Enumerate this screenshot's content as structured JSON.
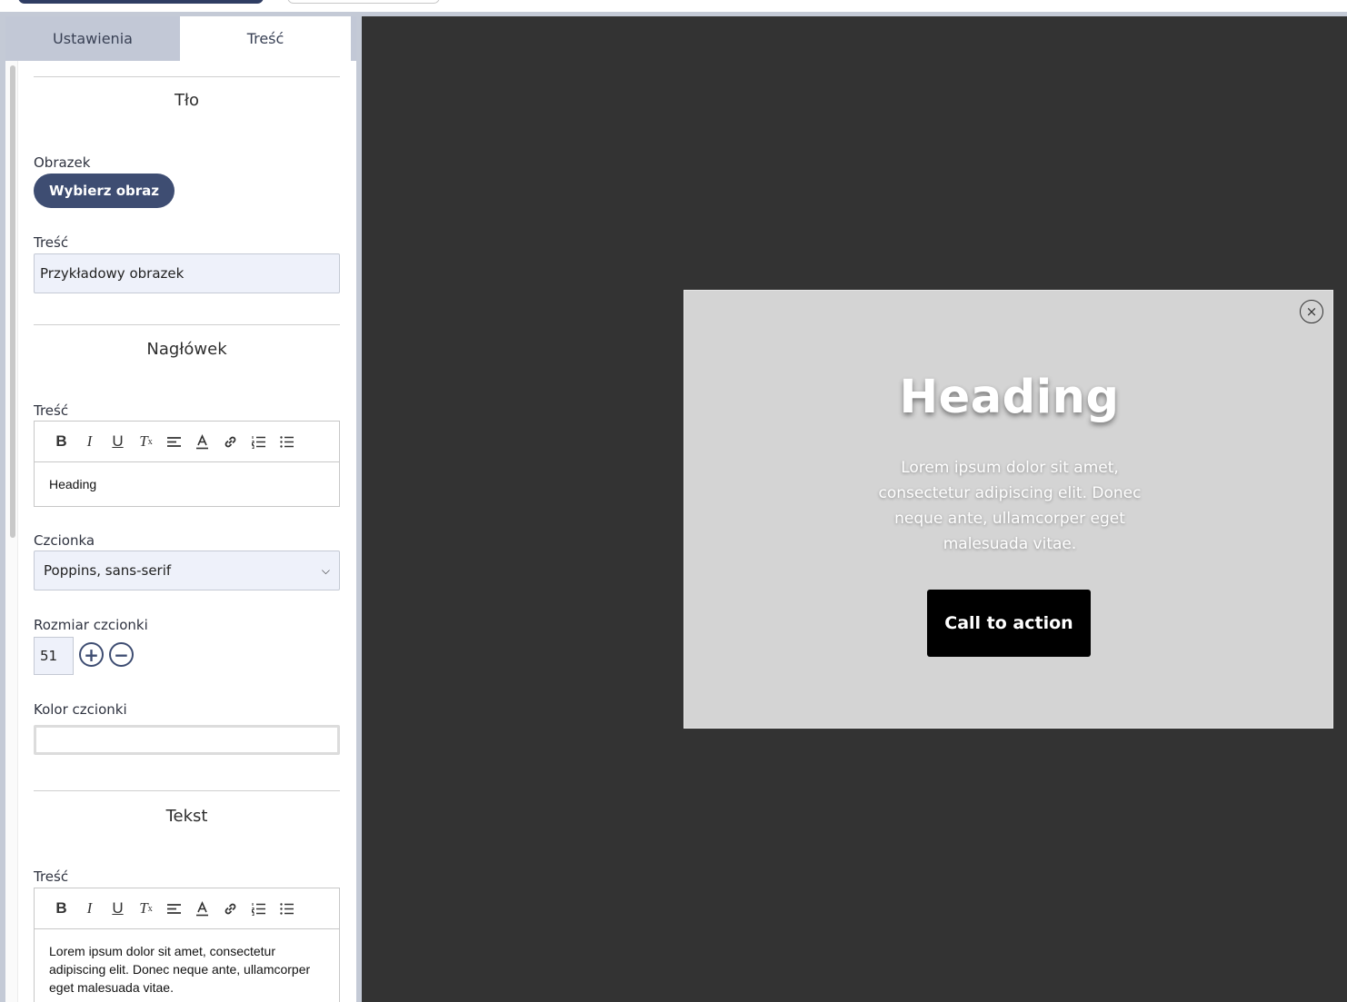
{
  "tabs": [
    {
      "label": "Ustawienia",
      "active": false
    },
    {
      "label": "Treść",
      "active": true
    }
  ],
  "background_section": {
    "title": "Tło",
    "image_label": "Obrazek",
    "choose_button": "Wybierz obraz",
    "content_label": "Treść",
    "content_value": "Przykładowy obrazek"
  },
  "heading_section": {
    "title": "Nagłówek",
    "content_label": "Treść",
    "editor_text": "Heading",
    "font_label": "Czcionka",
    "font_value": "Poppins, sans-serif",
    "size_label": "Rozmiar czcionki",
    "size_value": "51",
    "color_label": "Kolor czcionki"
  },
  "text_section": {
    "title": "Tekst",
    "content_label": "Treść",
    "editor_text": "Lorem ipsum dolor sit amet, consectetur adipiscing elit. Donec neque ante, ullamcorper eget malesuada vitae."
  },
  "toolbar_icons": [
    "bold-icon",
    "italic-icon",
    "underline-icon",
    "clear-format-icon",
    "align-icon",
    "text-color-icon",
    "link-icon",
    "ordered-list-icon",
    "bullet-list-icon"
  ],
  "popup": {
    "heading": "Heading",
    "text": "Lorem ipsum dolor sit amet, consectetur adipiscing elit. Donec neque ante, ullamcorper eget malesuada vitae.",
    "cta": "Call to action",
    "close_symbol": "×"
  },
  "colors": {
    "accent": "#3e4d72",
    "preview_bg": "#333333",
    "popup_bg": "#d4d4d4",
    "cta_bg": "#000000"
  }
}
